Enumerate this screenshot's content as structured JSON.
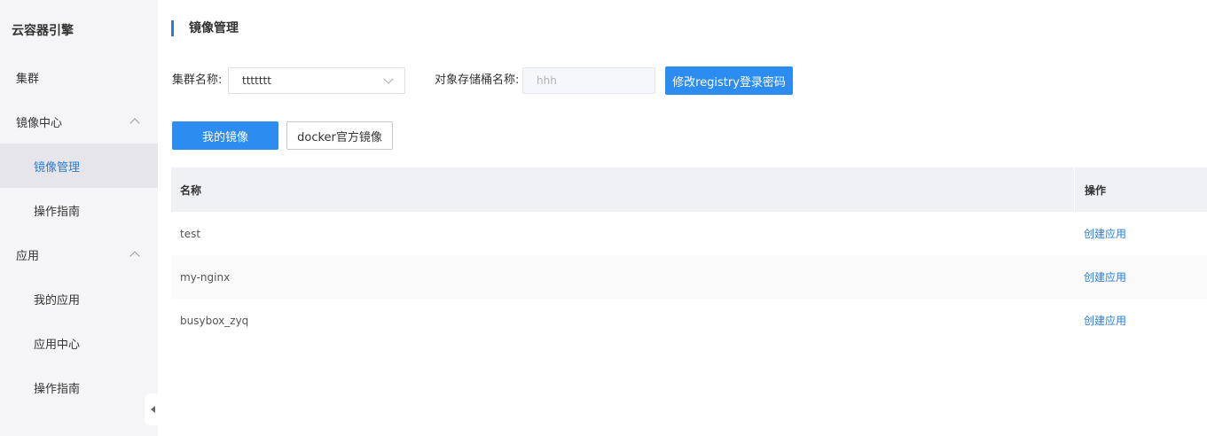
{
  "sidebar": {
    "title": "云容器引擎",
    "groups": [
      {
        "label": "集群"
      },
      {
        "label": "镜像中心"
      },
      {
        "label": "应用"
      }
    ],
    "items": [
      {
        "label": "镜像管理"
      },
      {
        "label": "操作指南"
      },
      {
        "label": "我的应用"
      },
      {
        "label": "应用中心"
      },
      {
        "label": "操作指南"
      }
    ]
  },
  "main": {
    "title": "镜像管理",
    "cluster_label": "集群名称:",
    "cluster_value": "ttttttt",
    "bucket_label": "对象存储桶名称:",
    "bucket_value": "hhh",
    "change_password_button": "修改registry登录密码",
    "tabs": [
      {
        "label": "我的镜像"
      },
      {
        "label": "docker官方镜像"
      }
    ]
  },
  "table": {
    "headers": {
      "name": "名称",
      "action": "操作"
    },
    "rows": [
      {
        "name": "test",
        "action": "创建应用"
      },
      {
        "name": "my-nginx",
        "action": "创建应用"
      },
      {
        "name": "busybox_zyq",
        "action": "创建应用"
      }
    ]
  },
  "colors": {
    "primary": "#2d8cf0",
    "link": "#2b7cd3",
    "sidebar_bg": "#f5f5f7",
    "table_header_bg": "#f0f1f5"
  }
}
